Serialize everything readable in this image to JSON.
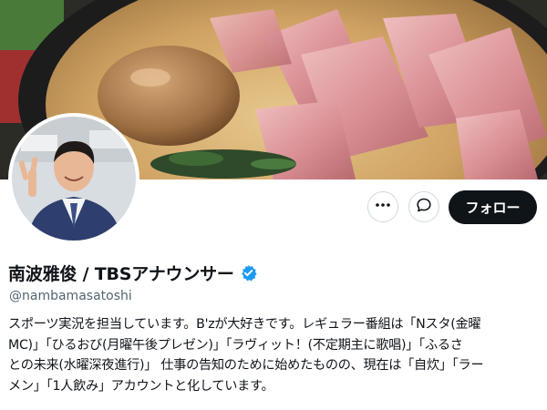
{
  "profile": {
    "display_name": "南波雅俊 / TBSアナウンサー",
    "handle": "@nambamasatoshi",
    "verified": true,
    "bio_lines": [
      "スポーツ実況を担当しています。B'zが大好きです。レギュラー番組は「Nスタ(金曜",
      "MC)」「ひるおび(月曜午後プレゼン)」「ラヴィット！(不定期主に歌唱)」「ふるさ",
      "との未来(水曜深夜進行)」 仕事の告知のために始めたものの、現在は「自炊」「ラー",
      "メン」「1人飲み」アカウントと化しています。"
    ]
  },
  "actions": {
    "more_icon": "more-dots-icon",
    "message_icon": "message-icon",
    "follow_label": "フォロー"
  },
  "colors": {
    "follow_bg": "#0f1419",
    "verified": "#1d9bf0",
    "secondary_text": "#536471"
  }
}
